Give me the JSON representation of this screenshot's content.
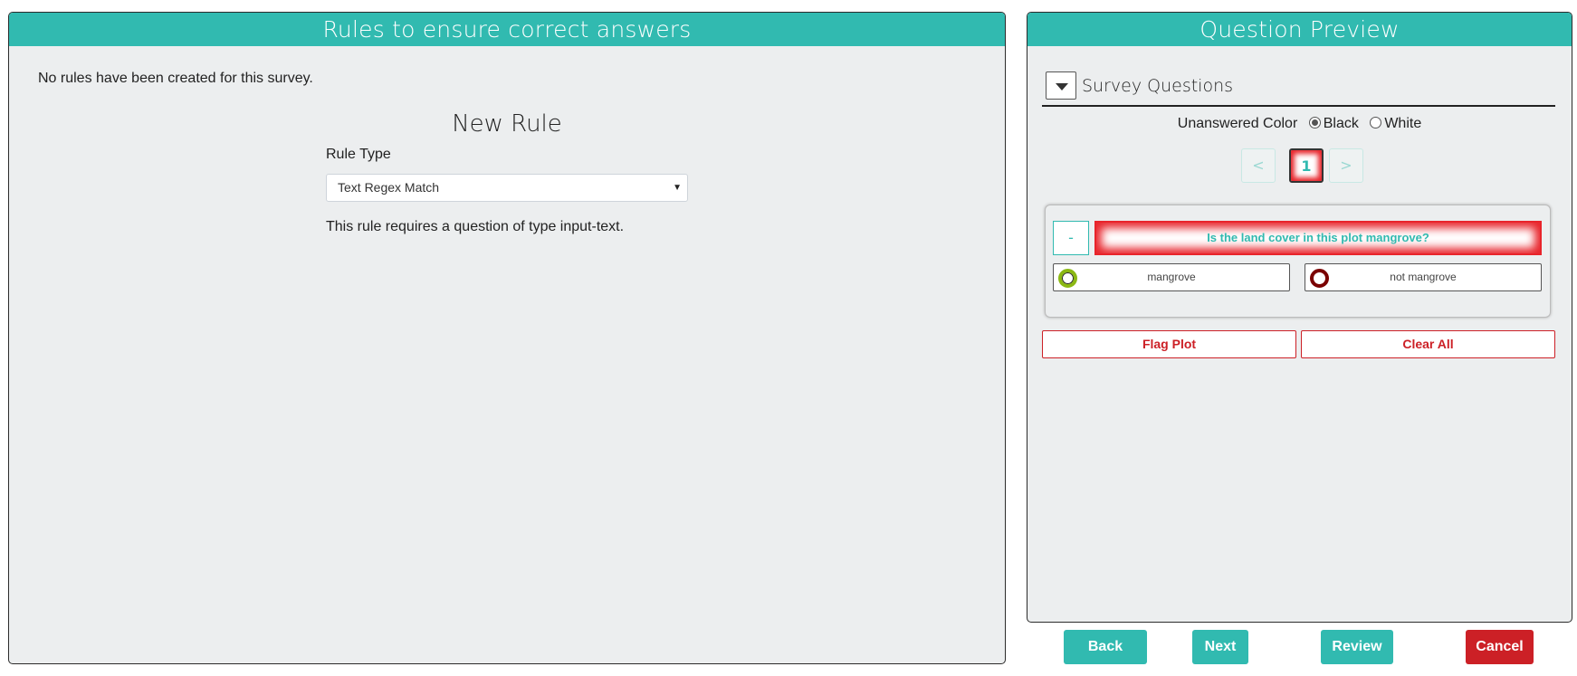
{
  "rules_panel": {
    "title": "Rules to ensure correct answers",
    "empty_message": "No rules have been created for this survey.",
    "new_rule": {
      "title": "New Rule",
      "rule_type_label": "Rule Type",
      "rule_type_selected": "Text Regex Match",
      "note": "This rule requires a question of type input-text."
    }
  },
  "preview_panel": {
    "title": "Question Preview",
    "section_title": "Survey Questions",
    "unanswered_color": {
      "label": "Unanswered Color",
      "options": [
        "Black",
        "White"
      ],
      "selected": "Black"
    },
    "pager": {
      "prev": "<",
      "current": "1",
      "next": ">"
    },
    "question": {
      "collapse_label": "-",
      "text": "Is the land cover in this plot mangrove?",
      "answers": [
        {
          "label": "mangrove",
          "color": "#8bb813"
        },
        {
          "label": "not mangrove",
          "color": "#7a0000"
        }
      ]
    },
    "actions": {
      "flag": "Flag Plot",
      "clear": "Clear All"
    }
  },
  "footer": {
    "back": "Back",
    "next": "Next",
    "review": "Review",
    "cancel": "Cancel"
  },
  "colors": {
    "accent": "#31bab0",
    "danger": "#cc2026"
  }
}
